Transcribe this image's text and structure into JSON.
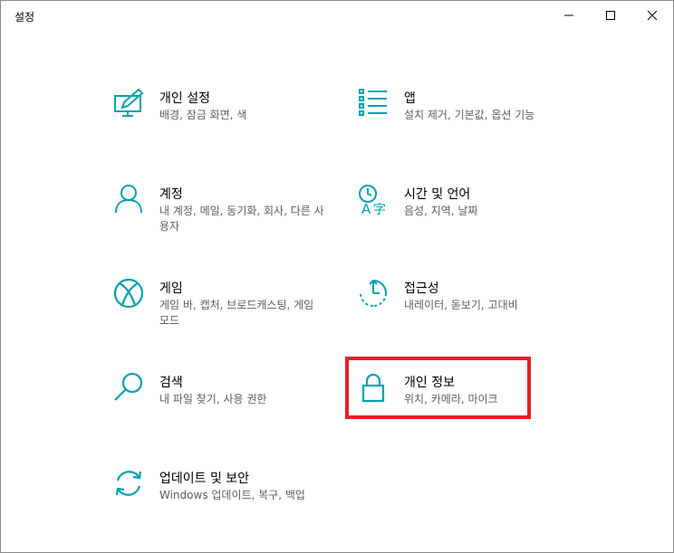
{
  "window": {
    "title": "설정"
  },
  "colors": {
    "accent": "#00a2ae",
    "highlight": "#e5202b"
  },
  "items": [
    {
      "label": "개인 설정",
      "desc": "배경, 잠금 화면, 색",
      "icon": "personalization-icon"
    },
    {
      "label": "앱",
      "desc": "설치 제거, 기본값, 옵션 기능",
      "icon": "apps-icon"
    },
    {
      "label": "계정",
      "desc": "내 계정, 메일, 동기화, 회사, 다른 사용자",
      "icon": "accounts-icon"
    },
    {
      "label": "시간 및 언어",
      "desc": "음성, 지역, 날짜",
      "icon": "time-language-icon"
    },
    {
      "label": "게임",
      "desc": "게임 바, 캡처, 브로드캐스팅, 게임 모드",
      "icon": "xbox-icon"
    },
    {
      "label": "접근성",
      "desc": "내레이터, 돋보기, 고대비",
      "icon": "ease-of-access-icon"
    },
    {
      "label": "검색",
      "desc": "내 파일 찾기, 사용 권한",
      "icon": "search-icon"
    },
    {
      "label": "개인 정보",
      "desc": "위치, 카메라, 마이크",
      "icon": "lock-icon"
    },
    {
      "label": "업데이트 및 보안",
      "desc": "Windows 업데이트, 복구, 백업",
      "icon": "update-sync-icon"
    }
  ]
}
